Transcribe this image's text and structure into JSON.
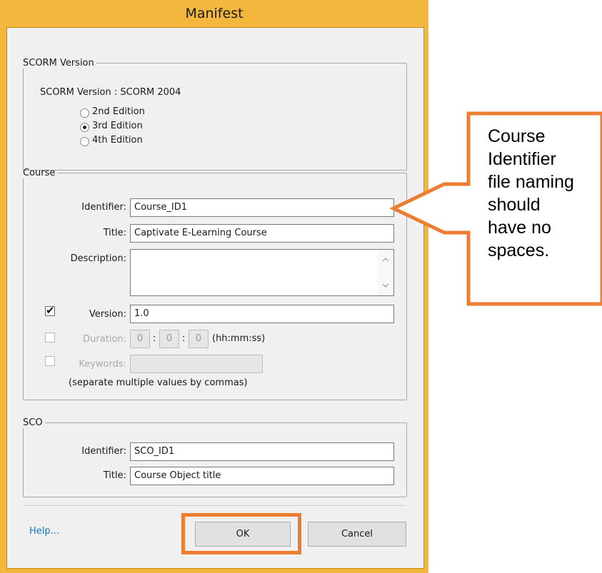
{
  "window": {
    "title": "Manifest"
  },
  "scorm": {
    "legend": "SCORM Version",
    "version_text": "SCORM Version : SCORM 2004",
    "editions": [
      {
        "label": "2nd Edition",
        "selected": false
      },
      {
        "label": "3rd Edition",
        "selected": true
      },
      {
        "label": "4th Edition",
        "selected": false
      }
    ]
  },
  "course": {
    "legend": "Course",
    "identifier_label": "Identifier:",
    "identifier_value": "Course_ID1",
    "title_label": "Title:",
    "title_value": "Captivate E-Learning Course",
    "description_label": "Description:",
    "description_value": "",
    "version_label": "Version:",
    "version_value": "1.0",
    "version_checked": true,
    "duration_label": "Duration:",
    "duration_hh": "0",
    "duration_mm": "0",
    "duration_ss": "0",
    "duration_sep": ":",
    "duration_format": "(hh:mm:ss)",
    "duration_checked": false,
    "keywords_label": "Keywords:",
    "keywords_value": "",
    "keywords_checked": false,
    "keywords_hint": "(separate multiple values by commas)"
  },
  "sco": {
    "legend": "SCO",
    "identifier_label": "Identifier:",
    "identifier_value": "SCO_ID1",
    "title_label": "Title:",
    "title_value": "Course Object title"
  },
  "footer": {
    "help_label": "Help...",
    "ok_label": "OK",
    "cancel_label": "Cancel"
  },
  "annotation": {
    "callout_lines": [
      "Course",
      "Identifier",
      "file naming",
      "should",
      "have no",
      "spaces."
    ],
    "highlight_color": "#ed7d31"
  }
}
